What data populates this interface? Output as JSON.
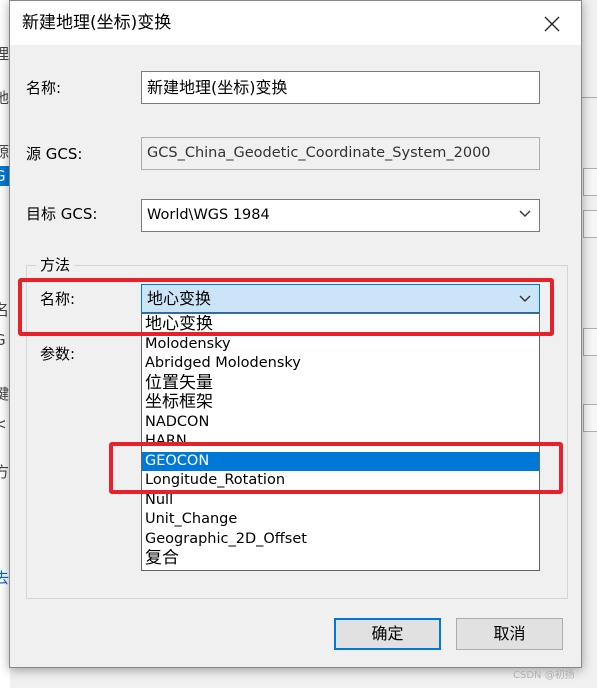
{
  "background": {
    "fragments": [
      "理",
      "地",
      "源",
      "G",
      "名",
      "G",
      "键",
      "<",
      "方",
      "去"
    ]
  },
  "dialog": {
    "title": "新建地理(坐标)变换",
    "close_icon": "close-icon",
    "name_label": "名称:",
    "name_value": "新建地理(坐标)变换",
    "source_gcs_label": "源 GCS:",
    "source_gcs_value": "GCS_China_Geodetic_Coordinate_System_2000",
    "target_gcs_label": "目标 GCS:",
    "target_gcs_value": "World\\WGS 1984",
    "method_group_title": "方法",
    "method_name_label": "名称:",
    "method_name_value": "地心变换",
    "params_label": "参数:",
    "method_options": [
      "地心变换",
      "Molodensky",
      "Abridged Molodensky",
      "位置矢量",
      "坐标框架",
      "NADCON",
      "HARN",
      "GEOCON",
      "Longitude_Rotation",
      "Null",
      "Unit_Change",
      "Geographic_2D_Offset",
      "复合"
    ],
    "highlighted_option": "GEOCON",
    "ok_label": "确定",
    "cancel_label": "取消"
  },
  "colors": {
    "accent": "#0078d7",
    "highlight_border": "#e8202a",
    "selection_bg": "#cce4f7"
  },
  "watermark": "CSDN @初扬"
}
